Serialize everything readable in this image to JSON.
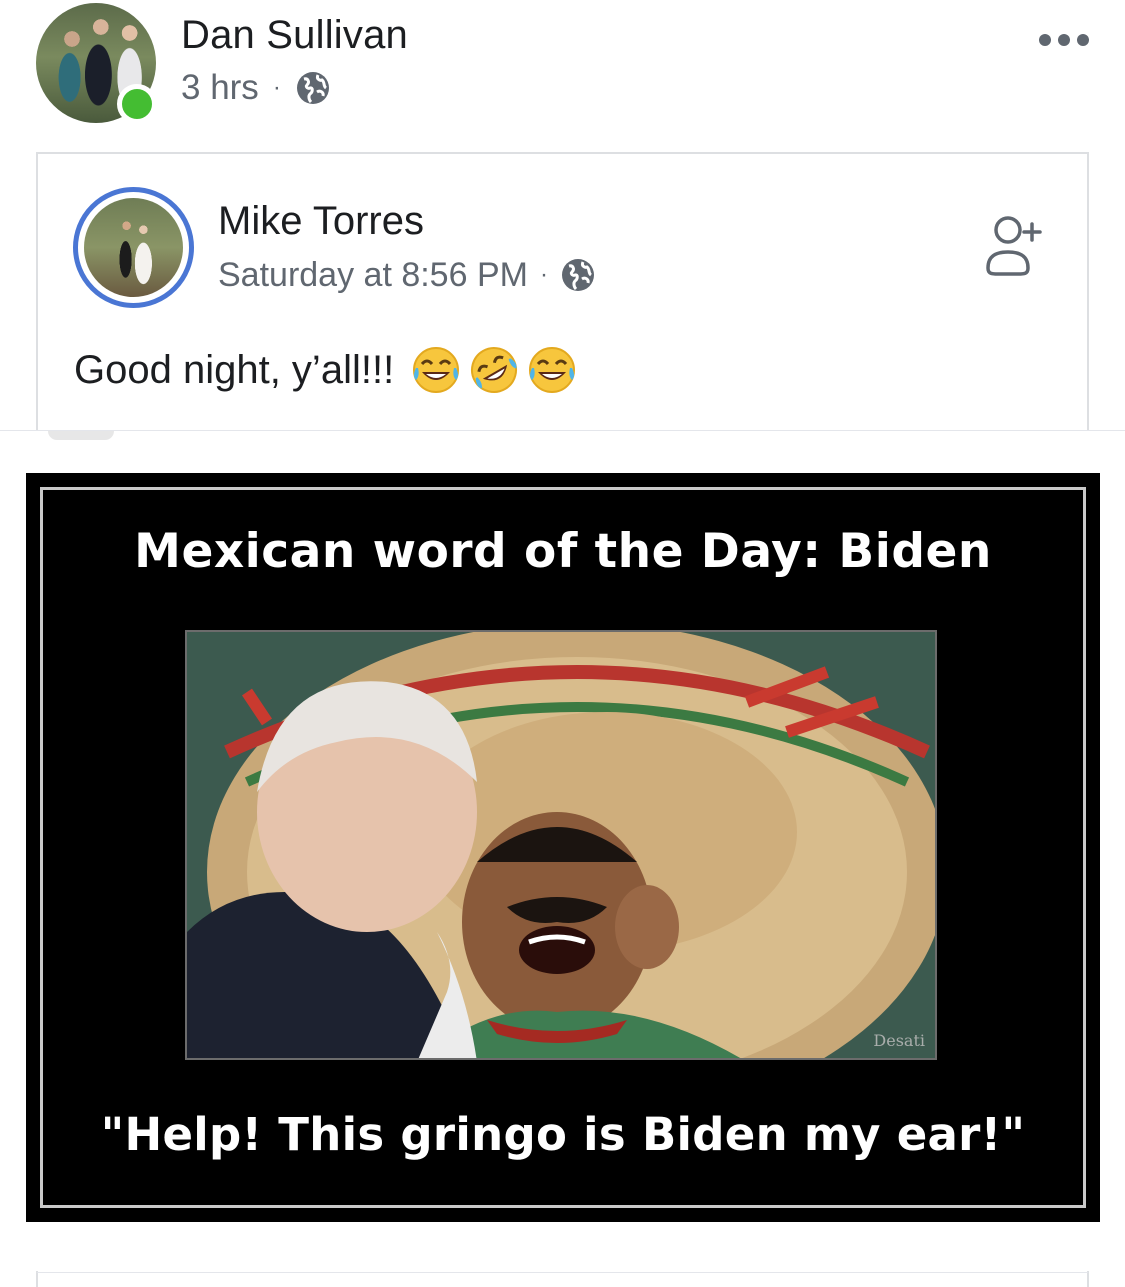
{
  "post": {
    "author": "Dan Sullivan",
    "time": "3 hrs",
    "separator": "·",
    "privacy_icon": "globe-icon",
    "menu_icon": "more-options-icon",
    "online_color": "#44bd32"
  },
  "shared": {
    "author": "Mike Torres",
    "time": "Saturday at 8:56 PM",
    "separator": "·",
    "privacy_icon": "globe-icon",
    "action_icon": "add-friend-icon",
    "ring_color": "#4a76d4",
    "text": "Good night, y’all!!!",
    "emojis": [
      "face-with-tears-of-joy",
      "rolling-on-the-floor-laughing",
      "face-with-tears-of-joy"
    ]
  },
  "meme": {
    "title": "Mexican word of the Day: Biden",
    "caption": "\"Help! This gringo is Biden my ear!\"",
    "watermark": "Desati"
  }
}
